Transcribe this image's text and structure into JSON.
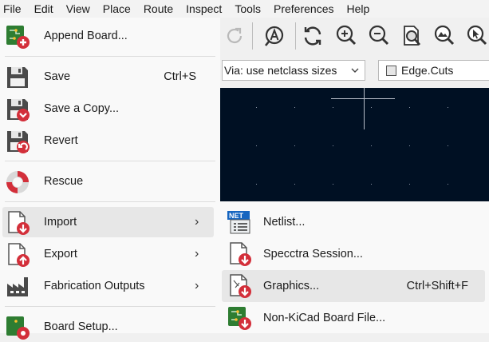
{
  "menubar": [
    "File",
    "Edit",
    "View",
    "Place",
    "Route",
    "Inspect",
    "Tools",
    "Preferences",
    "Help"
  ],
  "toolbar": {
    "icons": [
      "redo-icon",
      "net-inspector-icon",
      "refresh-icon",
      "zoom-in-icon",
      "zoom-out-icon",
      "zoom-fit-icon",
      "zoom-objects-icon",
      "zoom-selection-icon"
    ]
  },
  "selectors": {
    "via_size": "Via: use netclass sizes",
    "layer": "Edge.Cuts"
  },
  "file_menu": {
    "items": [
      {
        "label": "Append Board...",
        "shortcut": "",
        "icon": "append-board-icon"
      },
      {
        "label": "Save",
        "shortcut": "Ctrl+S",
        "icon": "save-icon"
      },
      {
        "label": "Save a Copy...",
        "shortcut": "",
        "icon": "save-copy-icon"
      },
      {
        "label": "Revert",
        "shortcut": "",
        "icon": "revert-icon"
      },
      {
        "label": "Rescue",
        "shortcut": "",
        "icon": "rescue-icon"
      },
      {
        "label": "Import",
        "shortcut": "",
        "icon": "import-icon",
        "submenu": true
      },
      {
        "label": "Export",
        "shortcut": "",
        "icon": "export-icon",
        "submenu": true
      },
      {
        "label": "Fabrication Outputs",
        "shortcut": "",
        "icon": "fabrication-icon",
        "submenu": true
      },
      {
        "label": "Board Setup...",
        "shortcut": "",
        "icon": "board-setup-icon"
      }
    ]
  },
  "import_submenu": {
    "items": [
      {
        "label": "Netlist...",
        "shortcut": "",
        "icon": "netlist-icon"
      },
      {
        "label": "Specctra Session...",
        "shortcut": "",
        "icon": "specctra-icon"
      },
      {
        "label": "Graphics...",
        "shortcut": "Ctrl+Shift+F",
        "icon": "graphics-icon"
      },
      {
        "label": "Non-KiCad Board File...",
        "shortcut": "",
        "icon": "non-kicad-board-icon"
      }
    ]
  },
  "colors": {
    "canvas": "#001023",
    "accent_red": "#d32f3a",
    "pcb_green": "#2e7d32"
  }
}
